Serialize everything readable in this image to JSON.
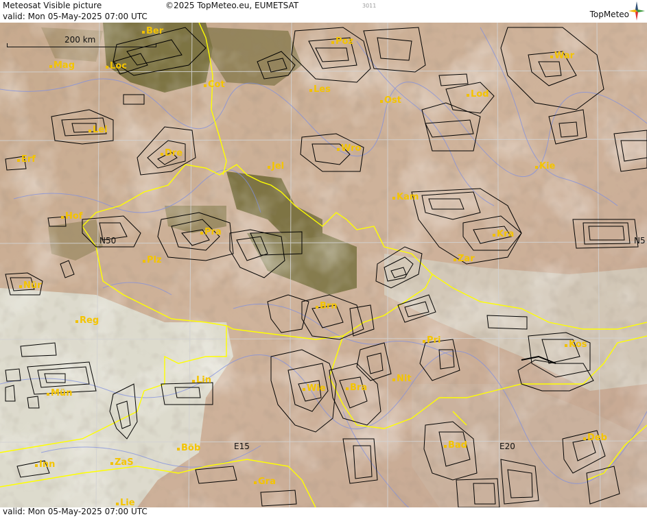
{
  "header": {
    "title": "Meteosat Visible picture",
    "valid": "valid:  Mon  05-May-2025  07:00 UTC",
    "copyright": "©2025 TopMeteo.eu, EUMETSAT",
    "image_id": "3011",
    "brand": "TopMeteo",
    "logo_icon": "compass-star-icon"
  },
  "footer": {
    "valid": "valid:  Mon  05-May-2025  07:00 UTC"
  },
  "scale": {
    "label": "200 km"
  },
  "colors": {
    "city_label": "#f4c400",
    "border": "#ffff00",
    "grid": "#cfcfcf",
    "rivers": "#7f8fe0",
    "contours": "#000000",
    "header_bg": "#ffffff"
  },
  "map": {
    "cities": [
      {
        "name": "Ber"
      },
      {
        "name": "Poz"
      },
      {
        "name": "War"
      },
      {
        "name": "Mag"
      },
      {
        "name": "Loc"
      },
      {
        "name": "Cot"
      },
      {
        "name": "Les"
      },
      {
        "name": "Ost"
      },
      {
        "name": "Lod"
      },
      {
        "name": "Lei"
      },
      {
        "name": "Dre"
      },
      {
        "name": "Wro"
      },
      {
        "name": "Erf"
      },
      {
        "name": "Jel"
      },
      {
        "name": "Kie"
      },
      {
        "name": "Kam"
      },
      {
        "name": "Hof"
      },
      {
        "name": "Pra"
      },
      {
        "name": "Kra"
      },
      {
        "name": "Plz"
      },
      {
        "name": "Zar"
      },
      {
        "name": "Nür"
      },
      {
        "name": "Brn"
      },
      {
        "name": "Reg"
      },
      {
        "name": "Pri"
      },
      {
        "name": "Kos"
      },
      {
        "name": "Nit"
      },
      {
        "name": "Lin"
      },
      {
        "name": "Mün"
      },
      {
        "name": "Wie"
      },
      {
        "name": "Bra"
      },
      {
        "name": "Böb"
      },
      {
        "name": "Bad"
      },
      {
        "name": "Deb"
      },
      {
        "name": "Inn"
      },
      {
        "name": "ZaS"
      },
      {
        "name": "Gra"
      },
      {
        "name": "Lie"
      }
    ],
    "grid_labels": [
      "N50",
      "N5",
      "E15",
      "E20"
    ]
  }
}
